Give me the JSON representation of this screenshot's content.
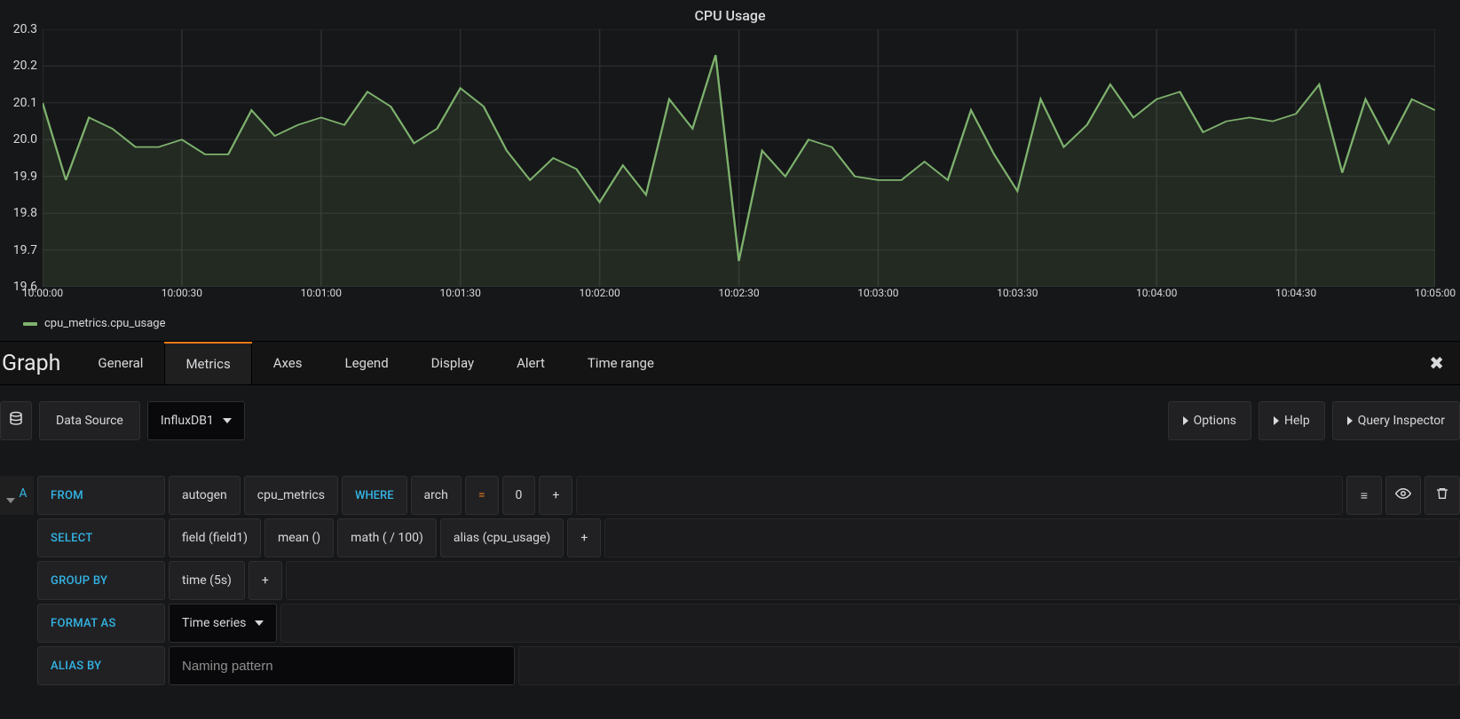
{
  "chart": {
    "title": "CPU Usage",
    "legend_label": "cpu_metrics.cpu_usage"
  },
  "chart_data": {
    "type": "line",
    "title": "CPU Usage",
    "xlabel": "",
    "ylabel": "",
    "ylim": [
      19.6,
      20.3
    ],
    "y_ticks": [
      20.3,
      20.2,
      20.1,
      20.0,
      19.9,
      19.8,
      19.7,
      19.6
    ],
    "x_ticks": [
      "10:00:00",
      "10:00:30",
      "10:01:00",
      "10:01:30",
      "10:02:00",
      "10:02:30",
      "10:03:00",
      "10:03:30",
      "10:04:00",
      "10:04:30",
      "10:05:00"
    ],
    "series": [
      {
        "name": "cpu_metrics.cpu_usage",
        "color": "#7eb26d",
        "x": [
          "10:00:00",
          "10:00:05",
          "10:00:10",
          "10:00:15",
          "10:00:20",
          "10:00:25",
          "10:00:30",
          "10:00:35",
          "10:00:40",
          "10:00:45",
          "10:00:50",
          "10:00:55",
          "10:01:00",
          "10:01:05",
          "10:01:10",
          "10:01:15",
          "10:01:20",
          "10:01:25",
          "10:01:30",
          "10:01:35",
          "10:01:40",
          "10:01:45",
          "10:01:50",
          "10:01:55",
          "10:02:00",
          "10:02:05",
          "10:02:10",
          "10:02:15",
          "10:02:20",
          "10:02:25",
          "10:02:30",
          "10:02:35",
          "10:02:40",
          "10:02:45",
          "10:02:50",
          "10:02:55",
          "10:03:00",
          "10:03:05",
          "10:03:10",
          "10:03:15",
          "10:03:20",
          "10:03:25",
          "10:03:30",
          "10:03:35",
          "10:03:40",
          "10:03:45",
          "10:03:50",
          "10:03:55",
          "10:04:00",
          "10:04:05",
          "10:04:10",
          "10:04:15",
          "10:04:20",
          "10:04:25",
          "10:04:30",
          "10:04:35",
          "10:04:40",
          "10:04:45",
          "10:04:50",
          "10:04:55",
          "10:05:00"
        ],
        "y": [
          20.1,
          19.89,
          20.06,
          20.03,
          19.98,
          19.98,
          20.0,
          19.96,
          19.96,
          20.08,
          20.01,
          20.04,
          20.06,
          20.04,
          20.13,
          20.09,
          19.99,
          20.03,
          20.14,
          20.09,
          19.97,
          19.89,
          19.95,
          19.92,
          19.83,
          19.93,
          19.85,
          20.11,
          20.03,
          20.23,
          19.67,
          19.97,
          19.9,
          20.0,
          19.98,
          19.9,
          19.89,
          19.89,
          19.94,
          19.89,
          20.08,
          19.96,
          19.86,
          20.11,
          19.98,
          20.04,
          20.15,
          20.06,
          20.11,
          20.13,
          20.02,
          20.05,
          20.06,
          20.05,
          20.07,
          20.15,
          19.91,
          20.11,
          19.99,
          20.11,
          20.08
        ]
      }
    ]
  },
  "tabs": {
    "section_label": "Graph",
    "items": [
      "General",
      "Metrics",
      "Axes",
      "Legend",
      "Display",
      "Alert",
      "Time range"
    ],
    "active": "Metrics"
  },
  "datasource": {
    "label": "Data Source",
    "selected": "InfluxDB1",
    "options_btn": "Options",
    "help_btn": "Help",
    "inspector_btn": "Query Inspector"
  },
  "query": {
    "id": "A",
    "from_kw": "FROM",
    "from_policy": "autogen",
    "from_measurement": "cpu_metrics",
    "where_kw": "WHERE",
    "where_key": "arch",
    "where_op": "=",
    "where_val": "0",
    "select_kw": "SELECT",
    "select_field": "field (field1)",
    "select_agg": "mean ()",
    "select_math": "math ( / 100)",
    "select_alias": "alias (cpu_usage)",
    "groupby_kw": "GROUP BY",
    "groupby_time": "time (5s)",
    "format_kw": "FORMAT AS",
    "format_value": "Time series",
    "alias_kw": "ALIAS BY",
    "alias_placeholder": "Naming pattern",
    "plus": "+"
  }
}
